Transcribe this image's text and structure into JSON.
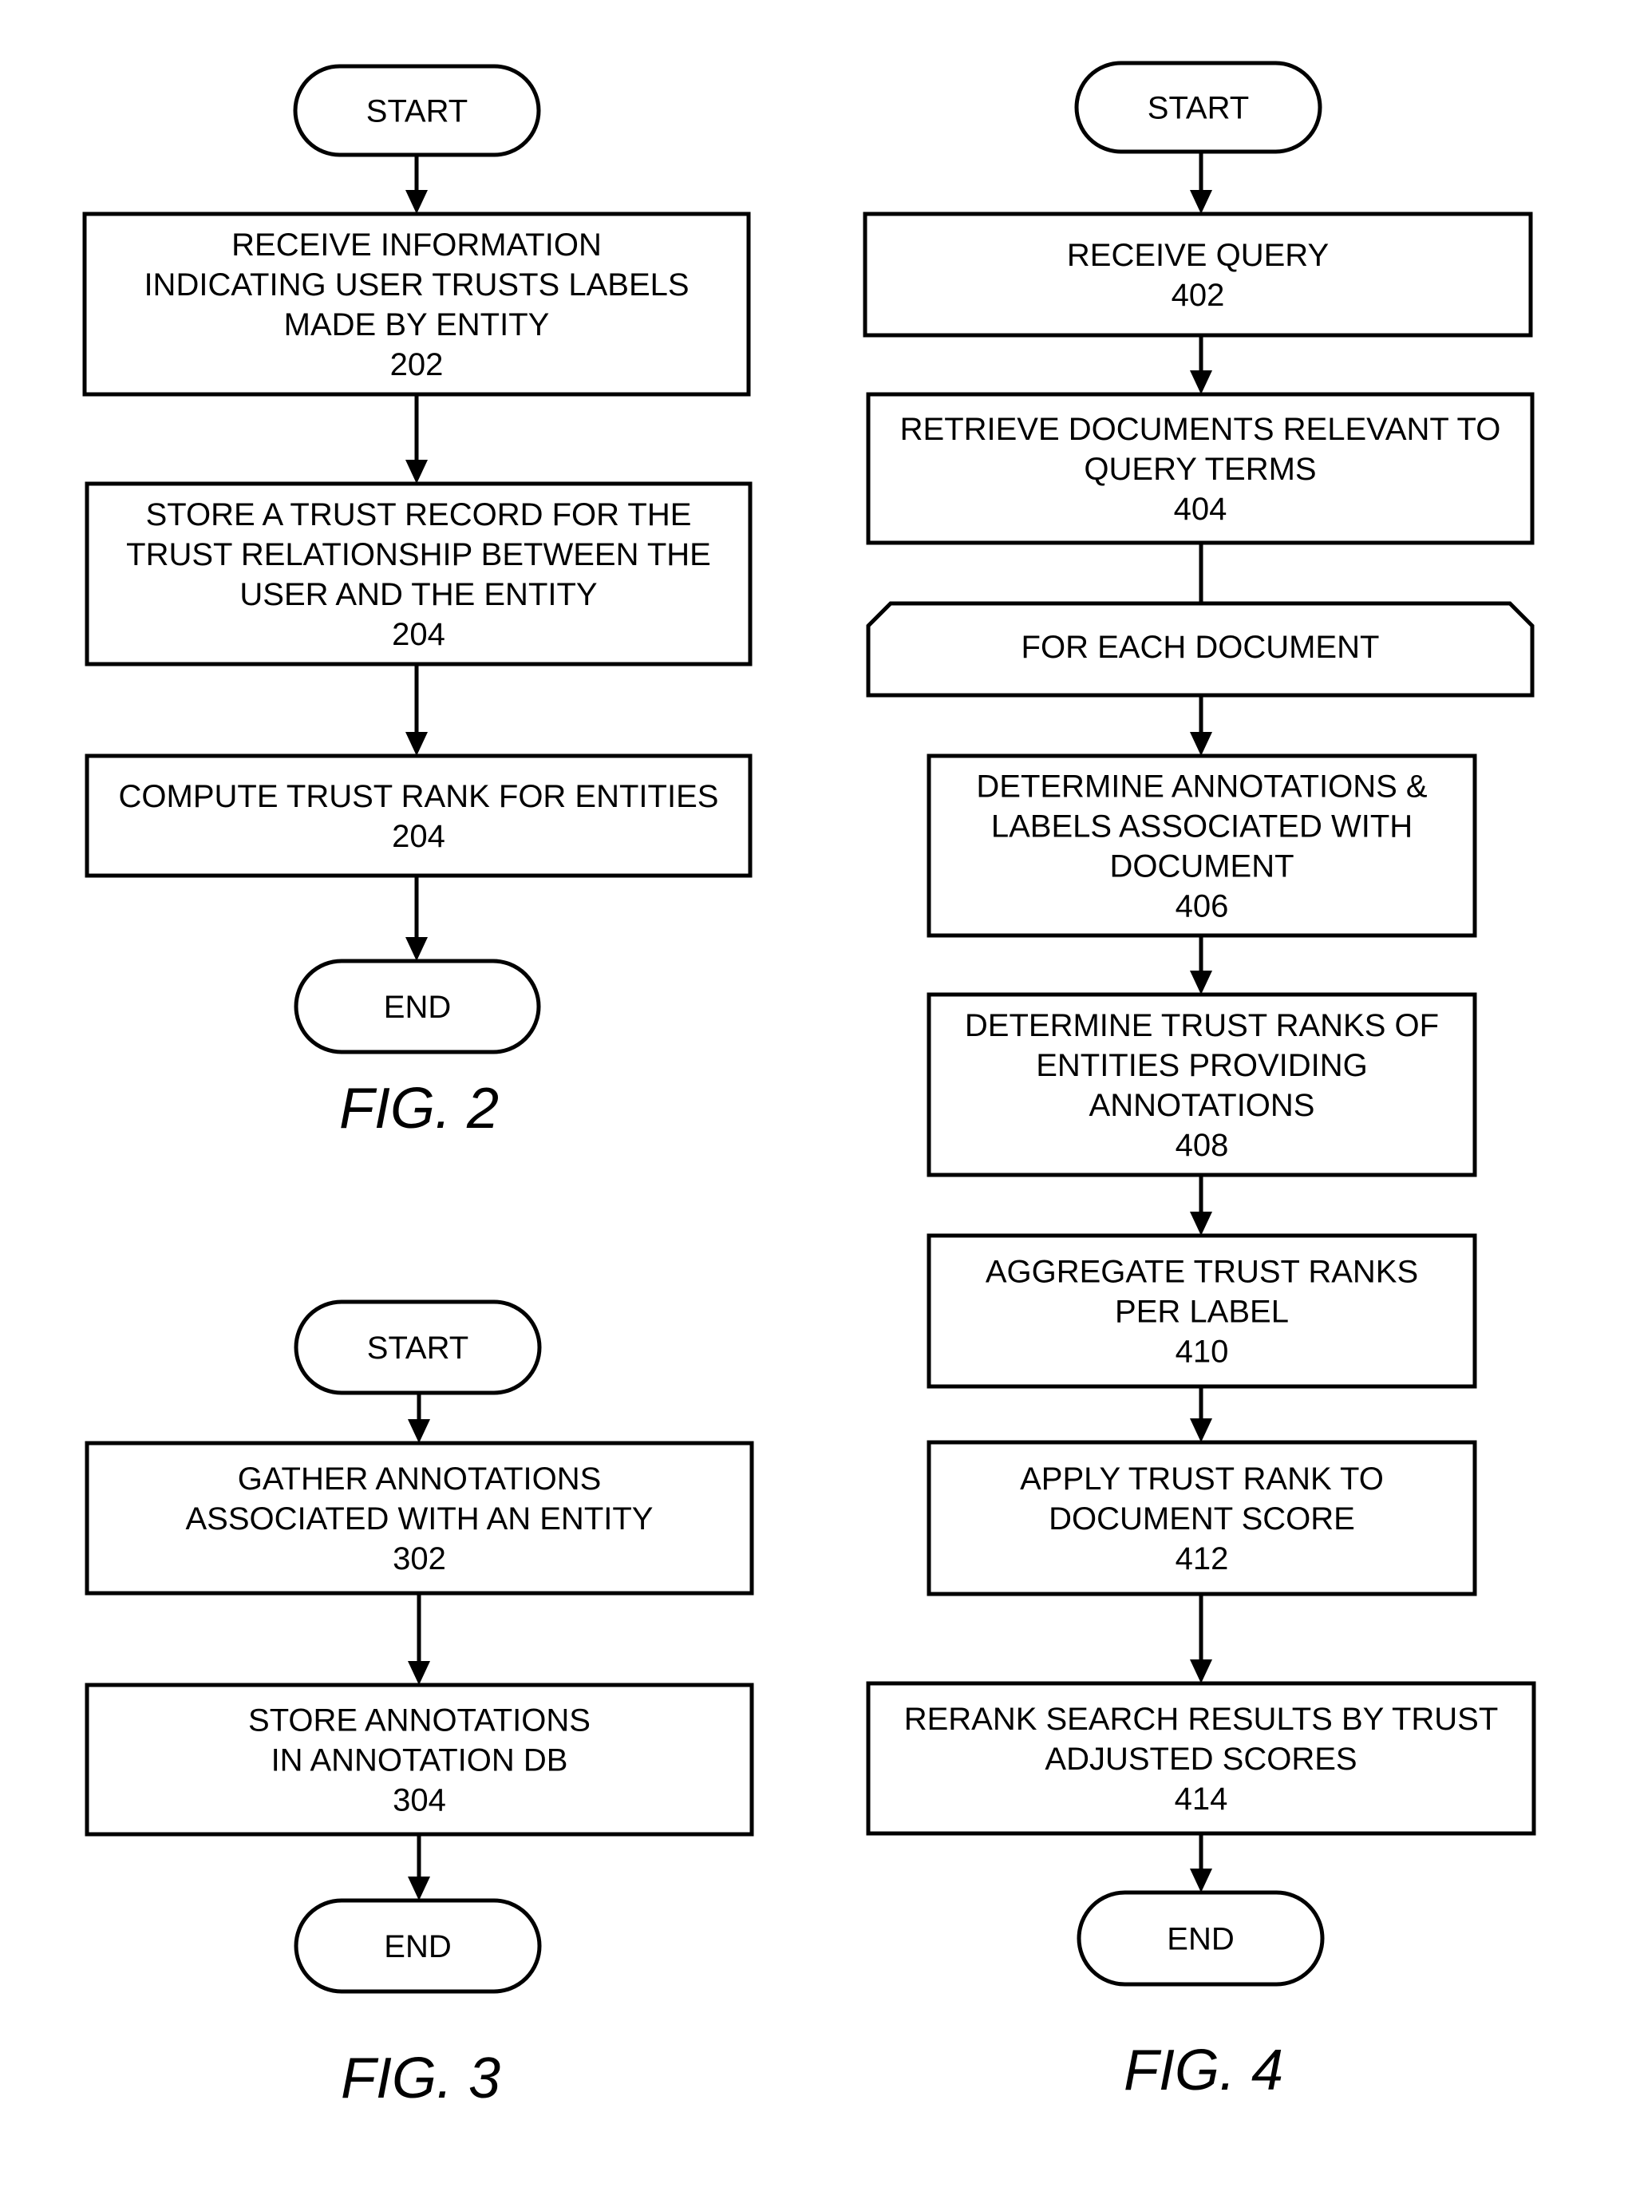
{
  "figures": [
    {
      "caption": "FIG. 2",
      "start": "START",
      "end": "END",
      "steps": [
        {
          "lines": [
            "RECEIVE INFORMATION",
            "INDICATING USER TRUSTS LABELS",
            "MADE BY ENTITY"
          ],
          "ref": "202"
        },
        {
          "lines": [
            "STORE A TRUST RECORD FOR THE",
            "TRUST RELATIONSHIP BETWEEN THE",
            "USER AND THE ENTITY"
          ],
          "ref": "204"
        },
        {
          "lines": [
            "COMPUTE TRUST RANK FOR ENTITIES"
          ],
          "ref": "204"
        }
      ]
    },
    {
      "caption": "FIG. 3",
      "start": "START",
      "end": "END",
      "steps": [
        {
          "lines": [
            "GATHER ANNOTATIONS",
            "ASSOCIATED WITH AN ENTITY"
          ],
          "ref": "302"
        },
        {
          "lines": [
            "STORE ANNOTATIONS",
            "IN ANNOTATION DB"
          ],
          "ref": "304"
        }
      ]
    },
    {
      "caption": "FIG. 4",
      "start": "START",
      "end": "END",
      "loop_label": "FOR EACH DOCUMENT",
      "steps": [
        {
          "lines": [
            "RECEIVE QUERY"
          ],
          "ref": "402"
        },
        {
          "lines": [
            "RETRIEVE DOCUMENTS RELEVANT TO",
            "QUERY TERMS"
          ],
          "ref": "404"
        },
        {
          "lines": [
            "DETERMINE ANNOTATIONS &",
            "LABELS ASSOCIATED WITH",
            "DOCUMENT"
          ],
          "ref": "406"
        },
        {
          "lines": [
            "DETERMINE TRUST RANKS OF",
            "ENTITIES PROVIDING",
            "ANNOTATIONS"
          ],
          "ref": "408"
        },
        {
          "lines": [
            "AGGREGATE TRUST RANKS",
            "PER LABEL"
          ],
          "ref": "410"
        },
        {
          "lines": [
            "APPLY TRUST RANK TO",
            "DOCUMENT SCORE"
          ],
          "ref": "412"
        },
        {
          "lines": [
            "RERANK SEARCH RESULTS BY TRUST",
            "ADJUSTED SCORES"
          ],
          "ref": "414"
        }
      ]
    }
  ]
}
